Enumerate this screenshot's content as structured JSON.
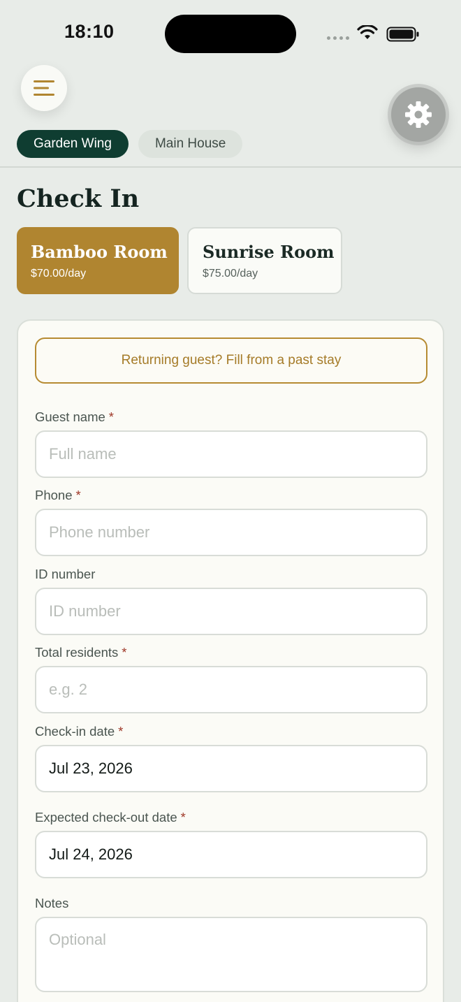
{
  "status_bar": {
    "time": "18:10"
  },
  "header": {
    "menu_icon": "hamburger-menu-icon",
    "settings_icon": "gear-icon",
    "wing_tabs": [
      {
        "label": "Garden Wing",
        "active": true
      },
      {
        "label": "Main House",
        "active": false
      }
    ]
  },
  "page": {
    "title": "Check In"
  },
  "rooms": [
    {
      "name": "Bamboo Room",
      "price": "$70.00/day",
      "selected": true
    },
    {
      "name": "Sunrise Room",
      "price": "$75.00/day",
      "selected": false
    }
  ],
  "form": {
    "returning_label": "Returning guest? Fill from a past stay",
    "required_marker": "*",
    "fields": {
      "guest_name": {
        "label": "Guest name",
        "placeholder": "Full name",
        "value": ""
      },
      "phone": {
        "label": "Phone",
        "placeholder": "Phone number",
        "value": ""
      },
      "id_number": {
        "label": "ID number",
        "placeholder": "ID number",
        "value": ""
      },
      "residents": {
        "label": "Total residents",
        "placeholder": "e.g. 2",
        "value": ""
      },
      "checkin": {
        "label": "Check-in date",
        "value": "Jul 23, 2026"
      },
      "checkout": {
        "label": "Expected check-out date",
        "value": "Jul 24, 2026"
      },
      "notes": {
        "label": "Notes",
        "placeholder": "Optional",
        "value": ""
      }
    }
  },
  "colors": {
    "accent_gold": "#b08530",
    "primary_green": "#0f3d31",
    "background": "#e8ece8",
    "required_red": "#a03a2a"
  }
}
